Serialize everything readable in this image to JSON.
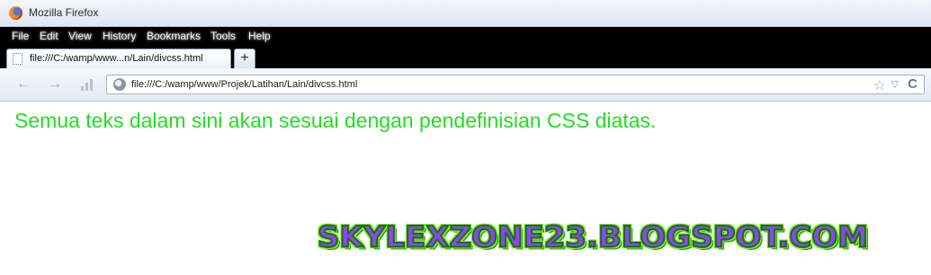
{
  "window": {
    "title": "Mozilla Firefox"
  },
  "menu": {
    "items": [
      "File",
      "Edit",
      "View",
      "History",
      "Bookmarks",
      "Tools",
      "Help"
    ]
  },
  "tab": {
    "label": "file:///C:/wamp/www...n/Lain/divcss.html",
    "new_tab_symbol": "+"
  },
  "nav": {
    "back_symbol": "←",
    "forward_symbol": "→",
    "url": "file:///C:/wamp/www/Projek/Latihan/Lain/divcss.html",
    "star_symbol": "☆",
    "dropdown_symbol": "▽",
    "reload_symbol": "C"
  },
  "page": {
    "text": "Semua teks dalam sini akan sesuai dengan pendefinisian CSS diatas.",
    "text_color": "#22dd22",
    "watermark": "SKYLEXZONE23.BLOGSPOT.COM"
  },
  "icons": [
    "firefox-logo",
    "page-icon",
    "back-icon",
    "forward-icon",
    "signal-icon",
    "globe-icon",
    "star-icon",
    "dropdown-icon",
    "reload-icon"
  ]
}
